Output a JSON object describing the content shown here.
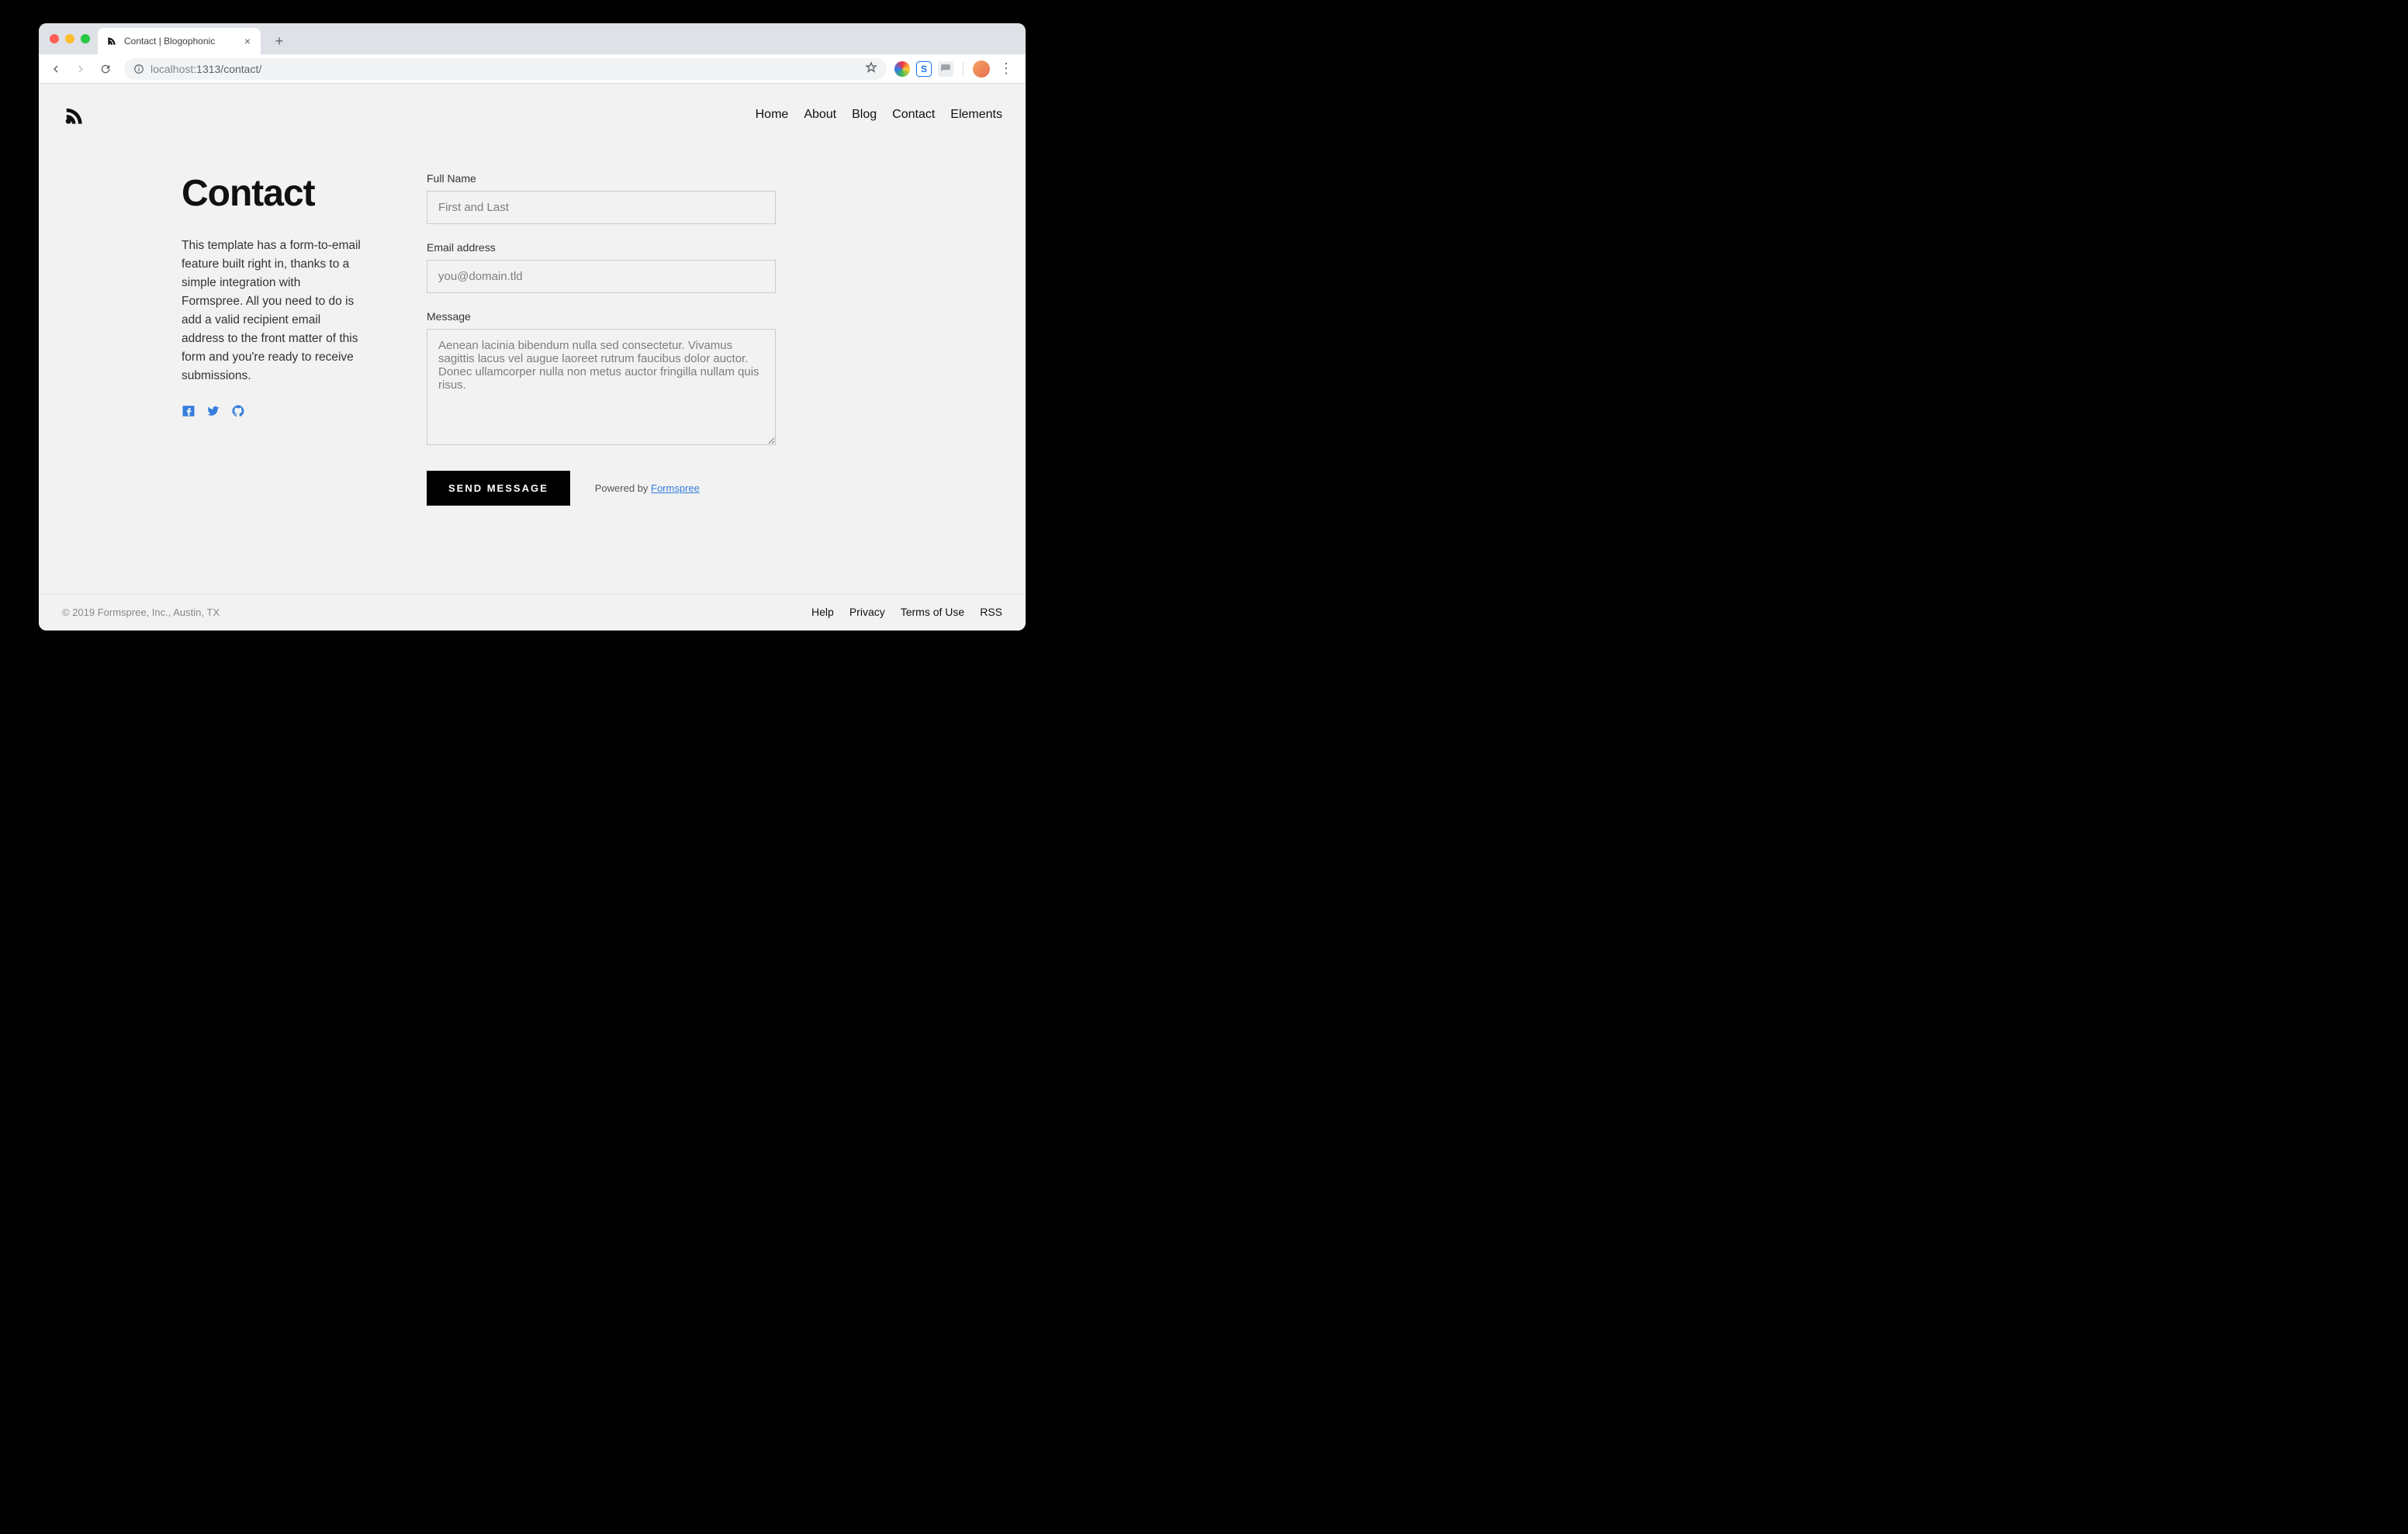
{
  "browser": {
    "tab_title": "Contact | Blogophonic",
    "url_host_muted": "localhost",
    "url_port_path": ":1313/contact/"
  },
  "nav": {
    "items": [
      "Home",
      "About",
      "Blog",
      "Contact",
      "Elements"
    ]
  },
  "page": {
    "title": "Contact",
    "intro": "This template has a form-to-email feature built right in, thanks to a simple integration with Formspree. All you need to do is add a valid recipient email address to the front matter of this form and you're ready to receive submissions."
  },
  "form": {
    "name_label": "Full Name",
    "name_placeholder": "First and Last",
    "email_label": "Email address",
    "email_placeholder": "you@domain.tld",
    "message_label": "Message",
    "message_placeholder": "Aenean lacinia bibendum nulla sed consectetur. Vivamus sagittis lacus vel augue laoreet rutrum faucibus dolor auctor. Donec ullamcorper nulla non metus auctor fringilla nullam quis risus.",
    "submit_label": "SEND MESSAGE",
    "powered_prefix": "Powered by ",
    "powered_link": "Formspree"
  },
  "footer": {
    "copyright": "© 2019 Formspree, Inc., Austin, TX",
    "links": [
      "Help",
      "Privacy",
      "Terms of Use",
      "RSS"
    ]
  }
}
